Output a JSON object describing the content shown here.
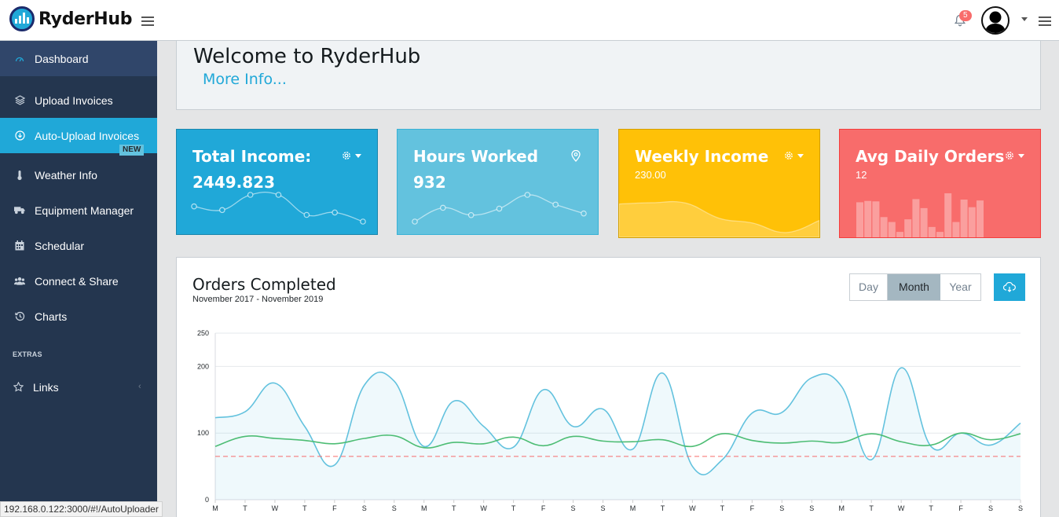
{
  "header": {
    "brand": "RyderHub",
    "notification_count": "5"
  },
  "sidebar": {
    "items": [
      {
        "label": "Dashboard",
        "icon": "speedometer-icon"
      },
      {
        "label": "Upload Invoices",
        "icon": "layers-icon"
      },
      {
        "label": "Auto-Upload Invoices",
        "icon": "arrow-down-circle-icon",
        "badge": "NEW"
      },
      {
        "label": "Weather Info",
        "icon": "thermometer-icon"
      },
      {
        "label": "Equipment Manager",
        "icon": "truck-icon"
      },
      {
        "label": "Schedular",
        "icon": "calendar-icon"
      },
      {
        "label": "Connect & Share",
        "icon": "users-icon"
      },
      {
        "label": "Charts",
        "icon": "history-icon"
      }
    ],
    "extras_title": "EXTRAS",
    "links_label": "Links"
  },
  "status_url": "192.168.0.122:3000/#!/AutoUploader",
  "welcome": {
    "title": "Welcome to RyderHub",
    "link": "More Info..."
  },
  "cards": [
    {
      "title": "Total Income:",
      "value": "2449.823",
      "color": "#20a8d8",
      "menu_icon": "gear-icon",
      "spark": [
        65,
        59,
        84,
        84,
        51,
        55,
        40
      ]
    },
    {
      "title": "Hours Worked",
      "value": "932",
      "color": "#63c2de",
      "menu_icon": "location-pin-icon",
      "spark": [
        1,
        18,
        9,
        17,
        34,
        22,
        11
      ]
    },
    {
      "title": "Weekly Income",
      "value": "230.00",
      "color": "#ffc107",
      "menu_icon": "gear-icon",
      "spark": [
        78,
        81,
        80,
        45,
        34,
        12,
        40
      ]
    },
    {
      "title": "Avg Daily Orders",
      "value": "12",
      "color": "#f86c6b",
      "menu_icon": "gear-icon",
      "bars": [
        78,
        81,
        80,
        45,
        34,
        12,
        40,
        85,
        65,
        23,
        12,
        98,
        34,
        84,
        67,
        82
      ]
    }
  ],
  "orders_panel": {
    "title": "Orders Completed",
    "subtitle": "November 2017 - November 2019",
    "range_buttons": [
      "Day",
      "Month",
      "Year"
    ],
    "selected_range": "Month",
    "download_icon": "cloud-download-icon"
  },
  "chart_data": {
    "type": "line",
    "x": [
      "M",
      "T",
      "W",
      "T",
      "F",
      "S",
      "S",
      "M",
      "T",
      "W",
      "T",
      "F",
      "S",
      "S",
      "M",
      "T",
      "W",
      "T",
      "F",
      "S",
      "S",
      "M",
      "T",
      "W",
      "T",
      "F",
      "S",
      "S"
    ],
    "ylim": [
      0,
      250
    ],
    "yticks": [
      0,
      100,
      200,
      250
    ],
    "grid": true,
    "series": [
      {
        "values": [
          123,
          132,
          175,
          110,
          52,
          172,
          178,
          80,
          148,
          110,
          79,
          165,
          110,
          136,
          76,
          190,
          50,
          60,
          130,
          131,
          183,
          170,
          60,
          198,
          80,
          100,
          82,
          115
        ],
        "color": "#63c2de",
        "fill": true
      },
      {
        "values": [
          80,
          95,
          92,
          89,
          84,
          92,
          96,
          78,
          86,
          84,
          94,
          81,
          95,
          88,
          87,
          90,
          80,
          99,
          89,
          85,
          88,
          86,
          99,
          87,
          82,
          100,
          90,
          99
        ],
        "color": "#4dbd74",
        "fill": false
      },
      {
        "values": [
          65,
          65,
          65,
          65,
          65,
          65,
          65,
          65,
          65,
          65,
          65,
          65,
          65,
          65,
          65,
          65,
          65,
          65,
          65,
          65,
          65,
          65,
          65,
          65,
          65,
          65,
          65,
          65
        ],
        "color": "#f86c6b",
        "dashed": true
      }
    ]
  }
}
